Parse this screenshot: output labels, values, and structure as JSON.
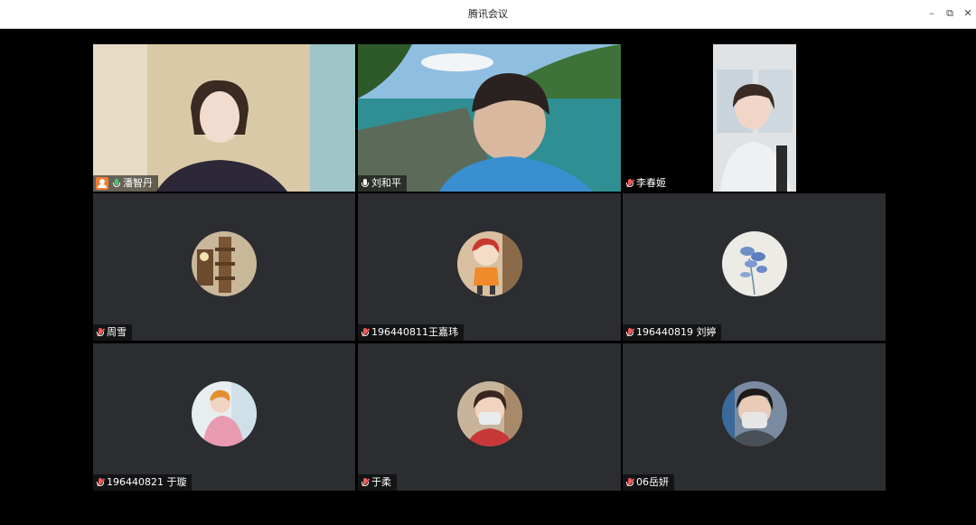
{
  "window": {
    "title": "腾讯会议",
    "minimize": "–",
    "restore": "⧉",
    "close": "✕"
  },
  "participants": [
    {
      "name": "潘智丹",
      "mic": "on",
      "host": true
    },
    {
      "name": "刘和平",
      "mic": "on"
    },
    {
      "name": "李春姬",
      "mic": "muted"
    },
    {
      "name": "周雪",
      "mic": "muted"
    },
    {
      "name": "196440811王嘉玮",
      "mic": "muted"
    },
    {
      "name": "196440819 刘婷",
      "mic": "muted"
    },
    {
      "name": "196440821 于璇",
      "mic": "muted"
    },
    {
      "name": "于柔",
      "mic": "muted"
    },
    {
      "name": "06岳妍",
      "mic": "muted"
    }
  ]
}
